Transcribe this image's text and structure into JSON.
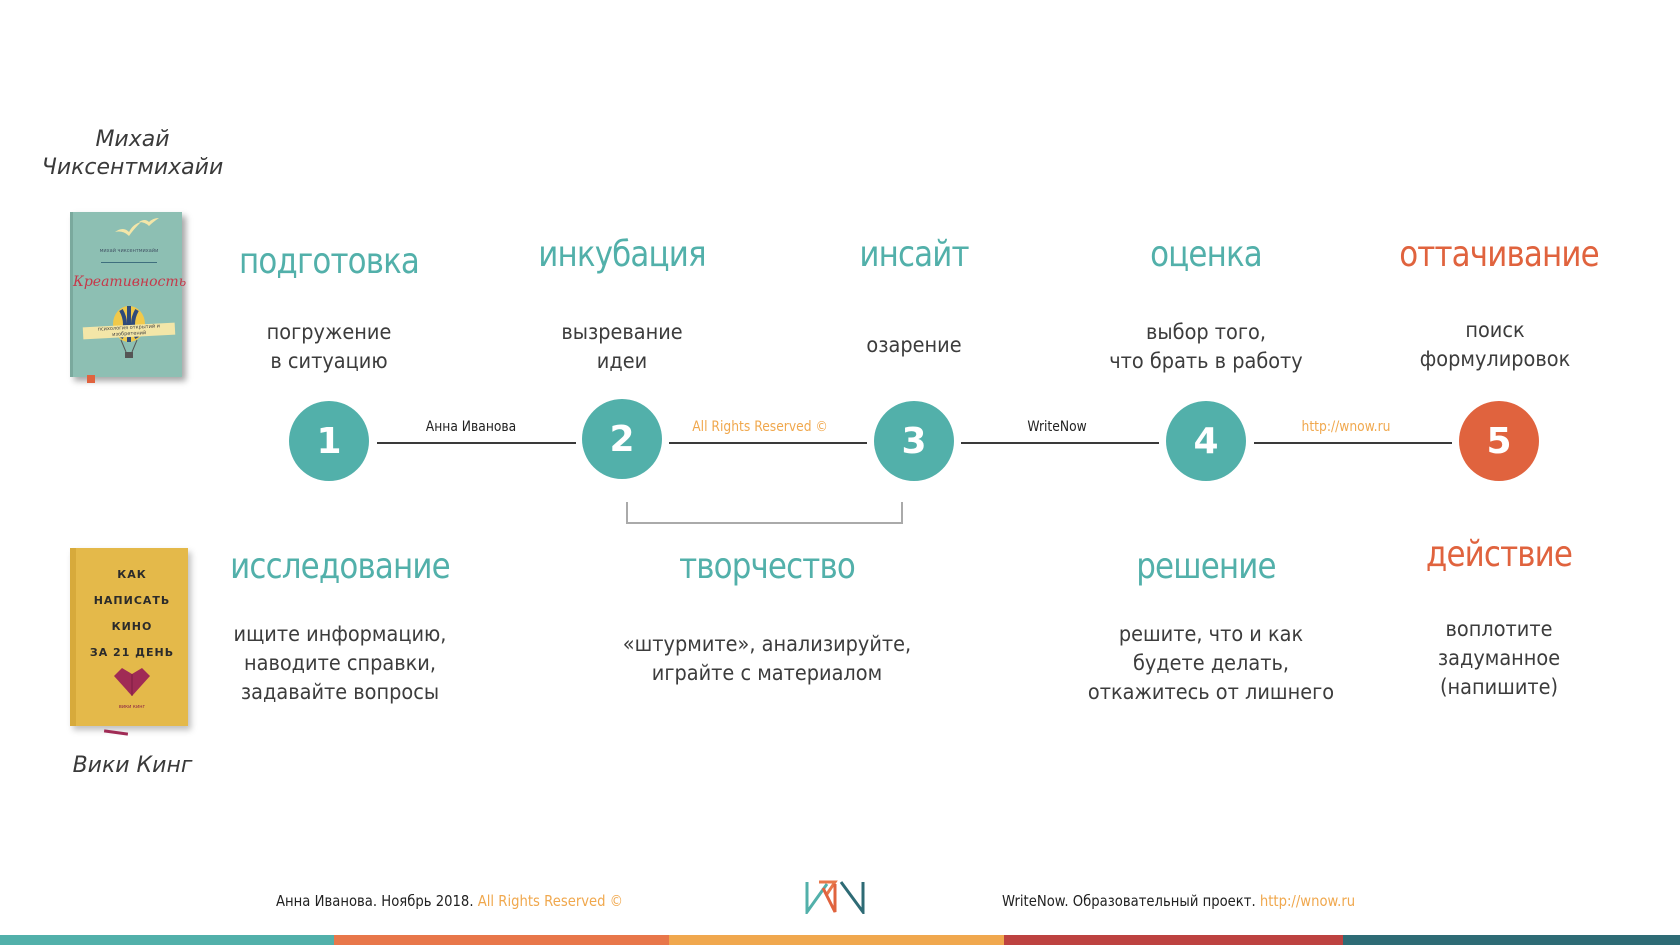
{
  "authors": {
    "top": {
      "line1": "Михай",
      "line2": "Чиксентмихайи"
    },
    "bottom": "Вики Кинг"
  },
  "books": {
    "top": {
      "title": "Креативность",
      "author_small": "михай чиксентмихайи",
      "subtitle": "психология открытий и изобретений",
      "icon": "hot-air-balloon-icon"
    },
    "bottom": {
      "line1": "КАК",
      "line2": "НАПИСАТЬ",
      "line3": "КИНО",
      "line4": "ЗА 21 ДЕНЬ",
      "author_small": "вики кинг",
      "icon": "heart-icon"
    }
  },
  "stages_top": [
    {
      "title": "подготовка",
      "desc1": "погружение",
      "desc2": "в ситуацию",
      "color": "#52b0aa"
    },
    {
      "title": "инкубация",
      "desc1": "вызревание",
      "desc2": "идеи",
      "color": "#52b0aa"
    },
    {
      "title": "инсайт",
      "desc1": "озарение",
      "desc2": "",
      "color": "#52b0aa"
    },
    {
      "title": "оценка",
      "desc1": "выбор того,",
      "desc2": "что брать в работу",
      "color": "#52b0aa"
    },
    {
      "title": "оттачивание",
      "desc1": "поиск",
      "desc2": "формулировок",
      "color": "#e0633e"
    }
  ],
  "steps": [
    {
      "number": "1",
      "color": "#52b0aa"
    },
    {
      "number": "2",
      "color": "#52b0aa"
    },
    {
      "number": "3",
      "color": "#52b0aa"
    },
    {
      "number": "4",
      "color": "#52b0aa"
    },
    {
      "number": "5",
      "color": "#e0633e"
    }
  ],
  "connectors": [
    {
      "label": "Анна Иванова",
      "color": "#222222"
    },
    {
      "label": "All Rights Reserved ©",
      "color": "#f0a84e"
    },
    {
      "label": "WriteNow",
      "color": "#222222"
    },
    {
      "label": "http://wnow.ru",
      "color": "#f0a84e"
    }
  ],
  "stages_bottom": [
    {
      "title": "исследование",
      "desc": [
        "ищите информацию,",
        "наводите справки,",
        "задавайте вопросы"
      ],
      "color": "#52b0aa"
    },
    {
      "title": "творчество",
      "desc": [
        "«штурмите», анализируйте,",
        "играйте с материалом"
      ],
      "color": "#52b0aa"
    },
    {
      "title": "решение",
      "desc": [
        "решите, что и как",
        "будете делать,",
        "откажитесь от лишнего"
      ],
      "color": "#52b0aa"
    },
    {
      "title": "действие",
      "desc": [
        "воплотите",
        "задуманное",
        "(напишите)"
      ],
      "color": "#e0633e"
    }
  ],
  "footer": {
    "left_text": "Анна Иванова. Ноябрь 2018.",
    "left_highlight": "All Rights Reserved ©",
    "logo": "writenow-logo",
    "right_text": "WriteNow. Образовательный проект.",
    "right_link": "http://wnow.ru"
  },
  "palette": {
    "teal": "#52b0aa",
    "orange": "#e8774a",
    "gold": "#f0a84e",
    "red": "#bd4240",
    "dark_teal": "#2e6b75"
  }
}
